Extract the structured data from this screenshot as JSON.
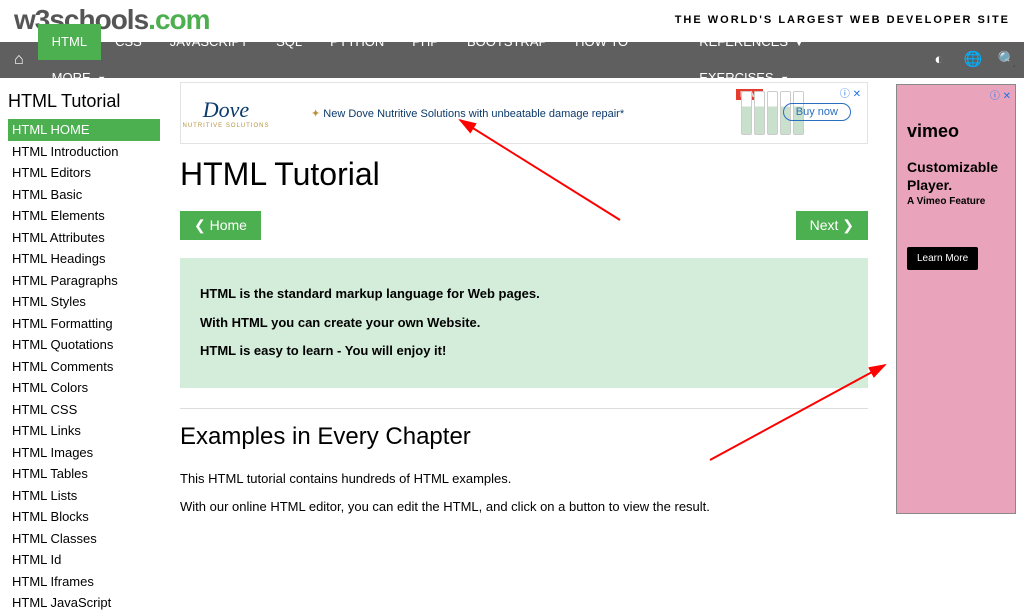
{
  "header": {
    "logo_w3": "w3schools",
    "logo_com": ".com",
    "tagline": "THE WORLD'S LARGEST WEB DEVELOPER SITE"
  },
  "nav": {
    "items": [
      "HTML",
      "CSS",
      "JAVASCRIPT",
      "SQL",
      "PYTHON",
      "PHP",
      "BOOTSTRAP",
      "HOW TO",
      "MORE"
    ],
    "active": 0,
    "right": [
      "REFERENCES",
      "EXERCISES"
    ]
  },
  "sidebar": {
    "title": "HTML Tutorial",
    "items": [
      "HTML HOME",
      "HTML Introduction",
      "HTML Editors",
      "HTML Basic",
      "HTML Elements",
      "HTML Attributes",
      "HTML Headings",
      "HTML Paragraphs",
      "HTML Styles",
      "HTML Formatting",
      "HTML Quotations",
      "HTML Comments",
      "HTML Colors",
      "HTML CSS",
      "HTML Links",
      "HTML Images",
      "HTML Tables",
      "HTML Lists",
      "HTML Blocks",
      "HTML Classes",
      "HTML Id",
      "HTML Iframes",
      "HTML JavaScript"
    ],
    "active": 0
  },
  "top_ad": {
    "brand": "Dove",
    "brand_sub": "NUTRITIVE SOLUTIONS",
    "line": "New Dove Nutritive Solutions with unbeatable damage repair*",
    "new_tag": "NEW",
    "cta": "Buy now",
    "info_icon": "ⓘ",
    "close_icon": "✕"
  },
  "main": {
    "title": "HTML Tutorial",
    "home_btn": "Home",
    "next_btn": "Next",
    "intro": [
      "HTML is the standard markup language for Web pages.",
      "With HTML you can create your own Website.",
      "HTML is easy to learn - You will enjoy it!"
    ],
    "section_title": "Examples in Every Chapter",
    "section_text": [
      "This HTML tutorial contains hundreds of HTML examples.",
      "With our online HTML editor, you can edit the HTML, and click on a button to view the result."
    ]
  },
  "right_ad": {
    "brand": "vimeo",
    "heading": "Customizable Player.",
    "sub": "A Vimeo Feature",
    "cta": "Learn More",
    "info_icon": "ⓘ",
    "close_icon": "✕"
  }
}
